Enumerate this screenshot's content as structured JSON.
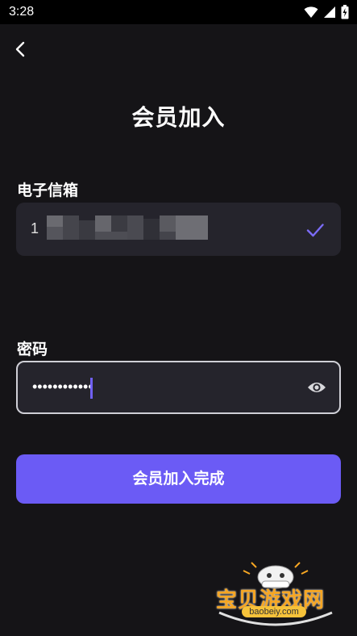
{
  "status_bar": {
    "time": "3:28"
  },
  "header": {
    "title": "会员加入"
  },
  "email": {
    "label": "电子信箱",
    "value_visible_prefix": "1"
  },
  "password": {
    "label": "密码",
    "value_masked": "••••••••••••"
  },
  "submit": {
    "label": "会员加入完成"
  },
  "watermark": {
    "text": "宝贝游戏网",
    "url": "baobeiy.com"
  },
  "colors": {
    "background": "#151417",
    "field_bg": "#25242c",
    "accent": "#6b5bf5",
    "check": "#7b6cf6"
  }
}
